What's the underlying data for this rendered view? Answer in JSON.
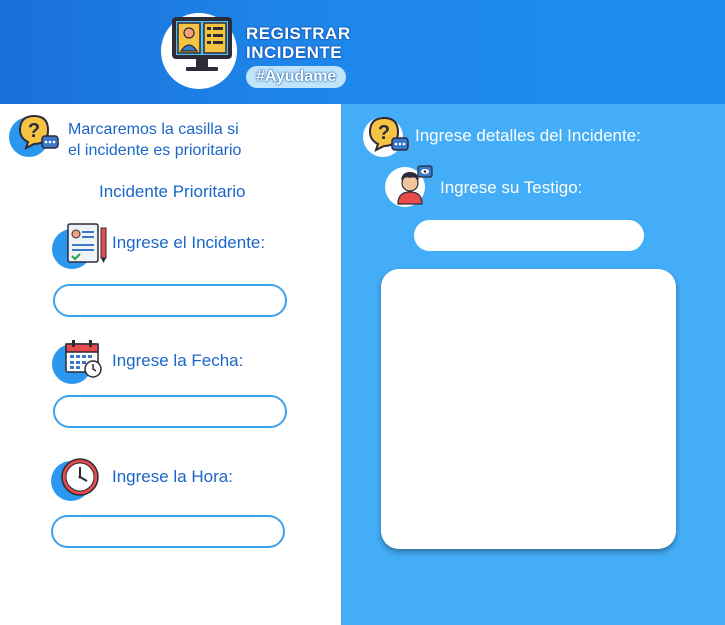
{
  "header": {
    "title_line1": "REGISTRAR",
    "title_line2": "INCIDENTE",
    "hashtag": "#Ayudame"
  },
  "left": {
    "note_line1": "Marcaremos la casilla si",
    "note_line2": "el incidente es prioritario",
    "priority_label": "Incidente Prioritario",
    "incident_label": "Ingrese el Incidente:",
    "date_label": "Ingrese la Fecha:",
    "time_label": "Ingrese la Hora:"
  },
  "right": {
    "details_label": "Ingrese detalles del Incidente:",
    "witness_label": "Ingrese su Testigo:"
  },
  "colors": {
    "header": "#1e86ea",
    "panel": "#44adf7",
    "label_blue": "#1a66c9",
    "field_border": "#3aa2ee"
  }
}
